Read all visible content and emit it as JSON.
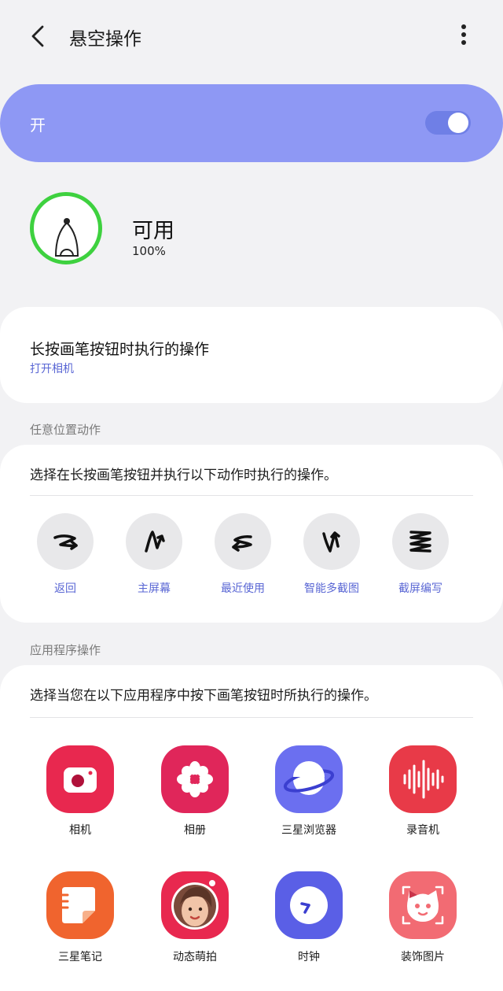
{
  "header": {
    "title": "悬空操作",
    "back_icon": "chevron-left-icon",
    "more_icon": "more-vertical-icon"
  },
  "master": {
    "label": "开",
    "enabled": true,
    "accent": "#8e98f4"
  },
  "pen": {
    "status": "可用",
    "battery": "100%",
    "ring_color": "#3ed13f"
  },
  "long_press": {
    "title": "长按画笔按钮时执行的操作",
    "value": "打开相机"
  },
  "anywhere": {
    "section": "任意位置动作",
    "description": "选择在长按画笔按钮并执行以下动作时执行的操作。",
    "gestures": [
      {
        "label": "返回",
        "icon": "gesture-back-icon"
      },
      {
        "label": "主屏幕",
        "icon": "gesture-home-icon"
      },
      {
        "label": "最近使用",
        "icon": "gesture-recent-icon"
      },
      {
        "label": "智能多截图",
        "icon": "gesture-smart-select-icon"
      },
      {
        "label": "截屏编写",
        "icon": "gesture-screen-write-icon"
      }
    ]
  },
  "apps": {
    "section": "应用程序操作",
    "description": "选择当您在以下应用程序中按下画笔按钮时所执行的操作。",
    "items": [
      {
        "label": "相机",
        "icon": "camera-icon",
        "color": "#e8284f"
      },
      {
        "label": "相册",
        "icon": "gallery-icon",
        "color": "#e0265a"
      },
      {
        "label": "三星浏览器",
        "icon": "browser-icon",
        "color": "#6b6ff0"
      },
      {
        "label": "录音机",
        "icon": "voice-recorder-icon",
        "color": "#e83a48"
      },
      {
        "label": "三星笔记",
        "icon": "notes-icon",
        "color": "#f0642e"
      },
      {
        "label": "动态萌拍",
        "icon": "ar-emoji-icon",
        "color": "#e8284f"
      },
      {
        "label": "时钟",
        "icon": "clock-icon",
        "color": "#5a5fe6"
      },
      {
        "label": "装饰图片",
        "icon": "decor-pic-icon",
        "color": "#f26b73"
      }
    ]
  }
}
